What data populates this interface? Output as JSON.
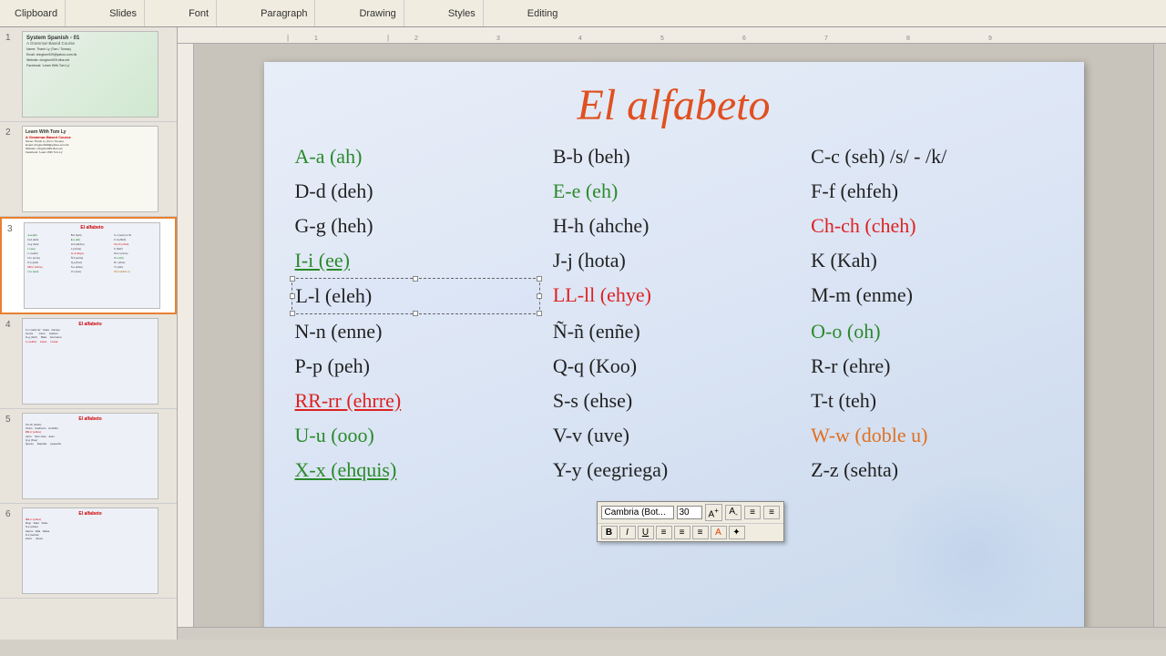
{
  "toolbar": {
    "groups": [
      "Clipboard",
      "Slides",
      "Font",
      "Paragraph",
      "Drawing",
      "Styles",
      "Editing"
    ]
  },
  "sidebar": {
    "slides": [
      {
        "number": "1",
        "title": "System Spanish - 01",
        "subtitle": "A Grammar-Based Course",
        "name_line": "Name: Thanh Ly (Tom / Tomas)",
        "email_line": "Email: chngtom929@yahoo.com.hk",
        "website_line": "Website: chngtom929.dtns.net",
        "facebook_line": "Facebook: 'Learn With Tom Ly'"
      },
      {
        "number": "2",
        "title": "Learn With Tom Ly",
        "course_title": "A Grammar-Based Course",
        "name_line": "Name: Thanh Ly (Tom / Tomas)",
        "email_line": "Email: chngtom929@yahoo.com.hk",
        "website_line": "Website: chngtom929.dtns.net",
        "facebook_line": "Facebook: 'Learn With Tom Ly'"
      },
      {
        "number": "3",
        "active": true,
        "preview_title": "El alfabeto"
      },
      {
        "number": "4",
        "preview_title": "El alfabeto"
      },
      {
        "number": "5",
        "preview_title": "El alfabeto"
      },
      {
        "number": "6",
        "preview_title": "El alfabeto"
      }
    ]
  },
  "slide": {
    "title": "El alfabeto",
    "alphabet": [
      {
        "text": "A-a (ah)",
        "color": "green"
      },
      {
        "text": "B-b (beh)",
        "color": "normal"
      },
      {
        "text": "C-c (seh) /s/ - /k/",
        "color": "normal"
      },
      {
        "text": "D-d (deh)",
        "color": "normal"
      },
      {
        "text": "E-e (eh)",
        "color": "green"
      },
      {
        "text": "F-f (ehfeh)",
        "color": "normal"
      },
      {
        "text": "G-g (heh)",
        "color": "normal"
      },
      {
        "text": "H-h (ahche)",
        "color": "normal"
      },
      {
        "text": "Ch-ch (cheh)",
        "color": "red"
      },
      {
        "text": "I-i (ee)",
        "color": "green"
      },
      {
        "text": "J-j (hota)",
        "color": "normal"
      },
      {
        "text": "K (Kah)",
        "color": "normal"
      },
      {
        "text": "L-l (eleh)",
        "color": "normal",
        "selected": true
      },
      {
        "text": "LL-ll (ehye)",
        "color": "red"
      },
      {
        "text": "M-m (enme)",
        "color": "normal"
      },
      {
        "text": "N-n (enne)",
        "color": "normal"
      },
      {
        "text": "Ñ-ñ (enñe)",
        "color": "normal"
      },
      {
        "text": "O-o (oh)",
        "color": "green"
      },
      {
        "text": "P-p (peh)",
        "color": "normal"
      },
      {
        "text": "Q-q (Koo)",
        "color": "normal"
      },
      {
        "text": "R-r (ehre)",
        "color": "normal"
      },
      {
        "text": "RR-rr (ehrre)",
        "color": "red",
        "underline": true
      },
      {
        "text": "S-s (ehse)",
        "color": "normal"
      },
      {
        "text": "T-t (teh)",
        "color": "normal"
      },
      {
        "text": "U-u (ooo)",
        "color": "green"
      },
      {
        "text": "V-v (uve)",
        "color": "normal"
      },
      {
        "text": "W-w (doble u)",
        "color": "orange"
      },
      {
        "text": "X-x (ehquis)",
        "color": "green",
        "underline": true
      },
      {
        "text": "Y-y (eegriega)",
        "color": "normal"
      },
      {
        "text": "Z-z (sehta)",
        "color": "normal"
      }
    ]
  },
  "floating_toolbar": {
    "font_name": "Cambria (Bot...",
    "font_size": "30",
    "buttons_row1": [
      "A↑",
      "A↓",
      "≡",
      "≡"
    ],
    "buttons_row2": [
      "B",
      "I",
      "U",
      "≡",
      "≡",
      "≡",
      "A",
      "✦"
    ]
  }
}
